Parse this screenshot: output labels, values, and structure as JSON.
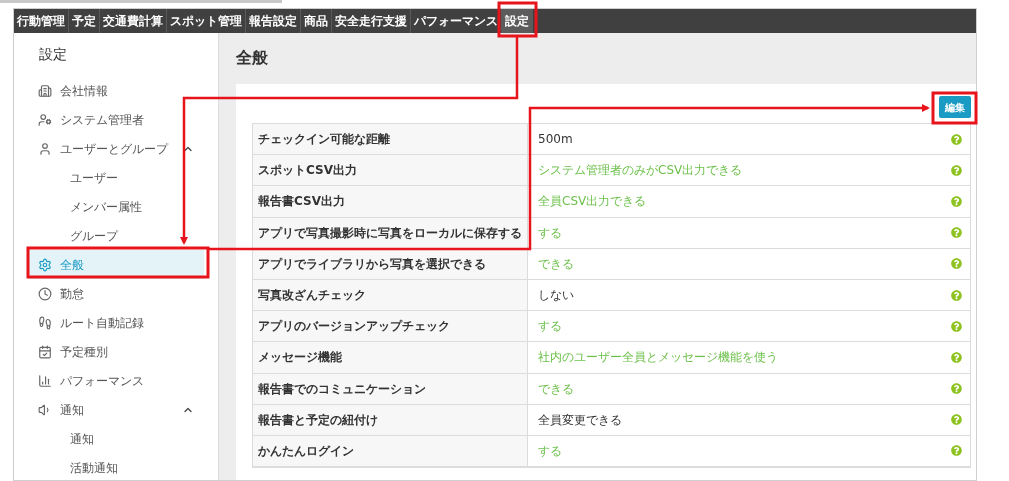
{
  "nav_tabs": [
    {
      "label": "行動管理",
      "selected": false
    },
    {
      "label": "予定",
      "selected": false
    },
    {
      "label": "交通費計算",
      "selected": false
    },
    {
      "label": "スポット管理",
      "selected": false
    },
    {
      "label": "報告設定",
      "selected": false
    },
    {
      "label": "商品",
      "selected": false
    },
    {
      "label": "安全走行支援",
      "selected": false
    },
    {
      "label": "パフォーマンス",
      "selected": false
    },
    {
      "label": "設定",
      "selected": true
    }
  ],
  "sidebar": {
    "title": "設定",
    "items": [
      {
        "label": "会社情報",
        "selected": false
      },
      {
        "label": "システム管理者",
        "selected": false
      },
      {
        "label": "ユーザーとグループ",
        "selected": false,
        "expanded": true,
        "children": [
          {
            "label": "ユーザー",
            "selected": false
          },
          {
            "label": "メンバー属性",
            "selected": false
          },
          {
            "label": "グループ",
            "selected": false
          }
        ]
      },
      {
        "label": "全般",
        "selected": true
      },
      {
        "label": "勤怠",
        "selected": false
      },
      {
        "label": "ルート自動記録",
        "selected": false
      },
      {
        "label": "予定種別",
        "selected": false
      },
      {
        "label": "パフォーマンス",
        "selected": false
      },
      {
        "label": "通知",
        "selected": false,
        "expanded": true,
        "children": [
          {
            "label": "通知",
            "selected": false
          },
          {
            "label": "活動通知",
            "selected": false
          }
        ]
      }
    ]
  },
  "page": {
    "title": "全般",
    "edit_button": "編集"
  },
  "settings": [
    {
      "label": "チェックイン可能な距離",
      "value": "500m",
      "highlighted": false
    },
    {
      "label": "スポットCSV出力",
      "value": "システム管理者のみがCSV出力できる",
      "highlighted": true
    },
    {
      "label": "報告書CSV出力",
      "value": "全員CSV出力できる",
      "highlighted": true
    },
    {
      "label": "アプリで写真撮影時に写真をローカルに保存する",
      "value": "する",
      "highlighted": true
    },
    {
      "label": "アプリでライブラリから写真を選択できる",
      "value": "できる",
      "highlighted": true
    },
    {
      "label": "写真改ざんチェック",
      "value": "しない",
      "highlighted": false
    },
    {
      "label": "アプリのバージョンアップチェック",
      "value": "する",
      "highlighted": true
    },
    {
      "label": "メッセージ機能",
      "value": "社内のユーザー全員とメッセージ機能を使う",
      "highlighted": true
    },
    {
      "label": "報告書でのコミュニケーション",
      "value": "できる",
      "highlighted": true
    },
    {
      "label": "報告書と予定の紐付け",
      "value": "全員変更できる",
      "highlighted": false
    },
    {
      "label": "かんたんログイン",
      "value": "する",
      "highlighted": true
    }
  ]
}
